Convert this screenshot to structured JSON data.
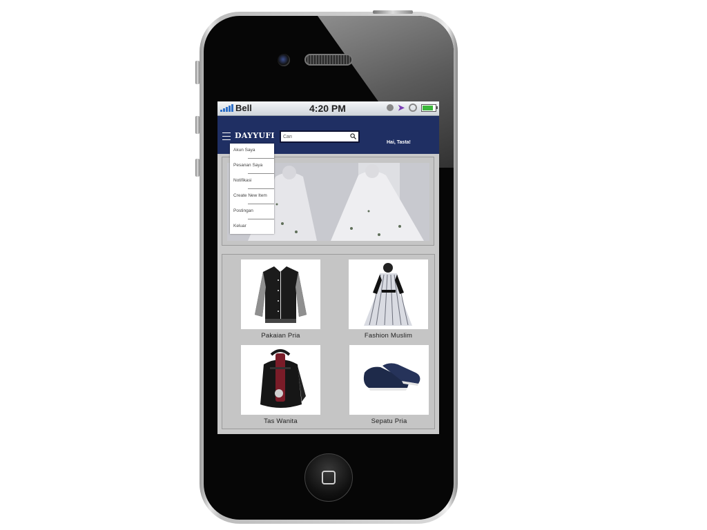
{
  "status_bar": {
    "carrier": "Bell",
    "time": "4:20 PM"
  },
  "app": {
    "brand": "DAYYUFI",
    "search_placeholder": "Cari",
    "greeting": "Hai, Tasta!"
  },
  "menu": {
    "items": [
      {
        "label": "Akun Saya"
      },
      {
        "label": "Pesanan Saya"
      },
      {
        "label": "Notifikasi"
      },
      {
        "label": "Create New Item"
      },
      {
        "label": "Postingan"
      },
      {
        "label": "Keluar"
      }
    ]
  },
  "categories": [
    {
      "label": "Pakaian Pria",
      "image": "black-varsity-jacket"
    },
    {
      "label": "Fashion Muslim",
      "image": "striped-gamis-dress"
    },
    {
      "label": "Tas Wanita",
      "image": "black-red-backpack"
    },
    {
      "label": "Sepatu Pria",
      "image": "navy-slip-on-shoes"
    }
  ],
  "colors": {
    "header": "#1f2f63",
    "content_background": "#c9c9c9"
  },
  "icons": {
    "menu": "hamburger-icon",
    "search": "search-icon",
    "home": "home-button-icon"
  }
}
